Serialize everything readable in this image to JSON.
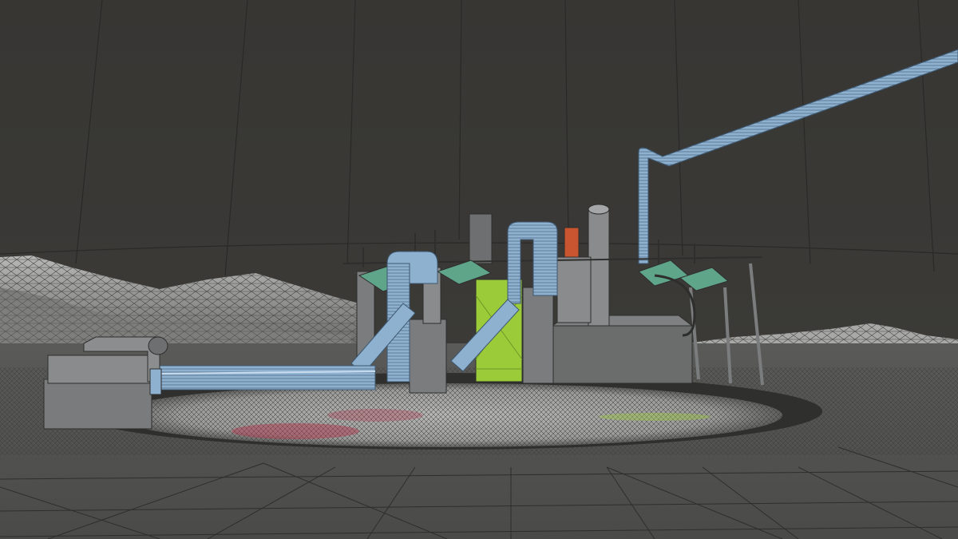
{
  "viewport": {
    "shading_mode": "wireframe",
    "colors": {
      "sky": "#3a3936",
      "sky_wire": "#2a2927",
      "ground": "#4f4f4d",
      "ground_wire": "#2e2e2d",
      "hills": "#8e8e8c",
      "hills_light": "#c8c8c6",
      "crater": "#a9a9a7",
      "machinery": "#7a7c7e",
      "pipe_blue": "#8fb1d0",
      "tank_green": "#9ccb3a",
      "panel_teal": "#5fa58a",
      "vent_orange": "#c8552f",
      "residue_red": "#b0304a"
    }
  },
  "scene_objects": [
    "sky-dome",
    "terrain-ground",
    "terrain-hills",
    "crater",
    "drill-rig",
    "green-tank",
    "blue-pipes",
    "solar-panels",
    "overhead-pipe",
    "outlet-box"
  ]
}
